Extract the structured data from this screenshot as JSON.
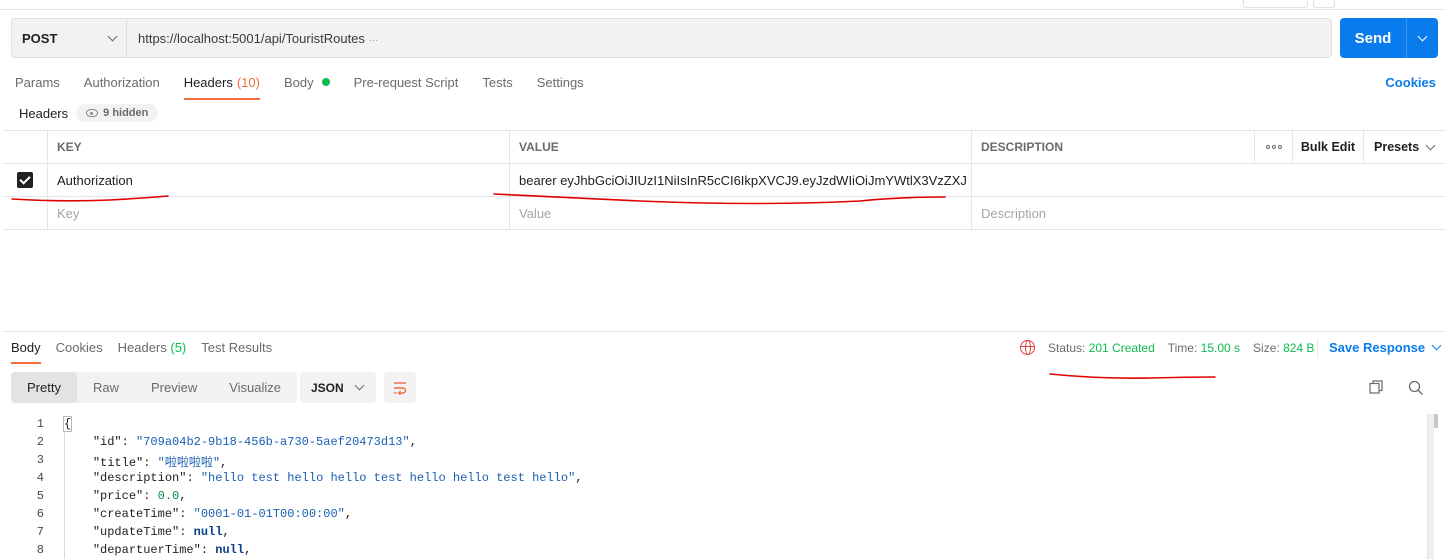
{
  "request": {
    "method": "POST",
    "url": "https://localhost:5001/api/TouristRoutes",
    "url_ellipsis": "...",
    "send_label": "Send"
  },
  "request_tabs": [
    {
      "label": "Params"
    },
    {
      "label": "Authorization"
    },
    {
      "label": "Headers",
      "count": "(10)"
    },
    {
      "label": "Body"
    },
    {
      "label": "Pre-request Script"
    },
    {
      "label": "Tests"
    },
    {
      "label": "Settings"
    }
  ],
  "cookies_link": "Cookies",
  "headers_section": {
    "label": "Headers",
    "hidden_label": "9 hidden"
  },
  "headers_table": {
    "columns": {
      "key": "KEY",
      "value": "VALUE",
      "description": "DESCRIPTION",
      "bulk_edit": "Bulk Edit",
      "presets": "Presets"
    },
    "rows": [
      {
        "checked": true,
        "key": "Authorization",
        "value": "bearer eyJhbGciOiJIUzI1NiIsInR5cCI6IkpXVCJ9.eyJzdWIiOiJmYWtlX3VzZXJ",
        "description": ""
      }
    ],
    "placeholders": {
      "key": "Key",
      "value": "Value",
      "description": "Description"
    }
  },
  "response_tabs": [
    {
      "label": "Body"
    },
    {
      "label": "Cookies"
    },
    {
      "label": "Headers",
      "count": "(5)"
    },
    {
      "label": "Test Results"
    }
  ],
  "response_status": {
    "status_label": "Status:",
    "status_value": "201 Created",
    "time_label": "Time:",
    "time_value": "15.00 s",
    "size_label": "Size:",
    "size_value": "824 B",
    "save_label": "Save Response"
  },
  "view_modes": [
    "Pretty",
    "Raw",
    "Preview",
    "Visualize"
  ],
  "format": "JSON",
  "code_lines": [
    {
      "n": "1",
      "text": "{"
    },
    {
      "n": "2",
      "key": "\"id\"",
      "value": "\"709a04b2-9b18-456b-a730-5aef20473d13\"",
      "type": "string"
    },
    {
      "n": "3",
      "key": "\"title\"",
      "value": "\"啦啦啦啦\"",
      "type": "string"
    },
    {
      "n": "4",
      "key": "\"description\"",
      "value": "\"hello test hello hello test hello hello test hello\"",
      "type": "string"
    },
    {
      "n": "5",
      "key": "\"price\"",
      "value": "0.0",
      "type": "number"
    },
    {
      "n": "6",
      "key": "\"createTime\"",
      "value": "\"0001-01-01T00:00:00\"",
      "type": "string"
    },
    {
      "n": "7",
      "key": "\"updateTime\"",
      "value": "null",
      "type": "keyword"
    },
    {
      "n": "8",
      "key": "\"departuerTime\"",
      "value": "null",
      "type": "keyword"
    }
  ],
  "colors": {
    "accent": "#f26b3a",
    "primary_blue": "#097bed",
    "status_green": "#0cbb52",
    "annotation_red": "#e00000"
  },
  "icons": [
    "chevron-down-icon",
    "eye-icon",
    "checkbox-checked-icon",
    "more-dots-icon",
    "globe-icon",
    "wrap-lines-icon",
    "copy-icon",
    "search-icon"
  ]
}
